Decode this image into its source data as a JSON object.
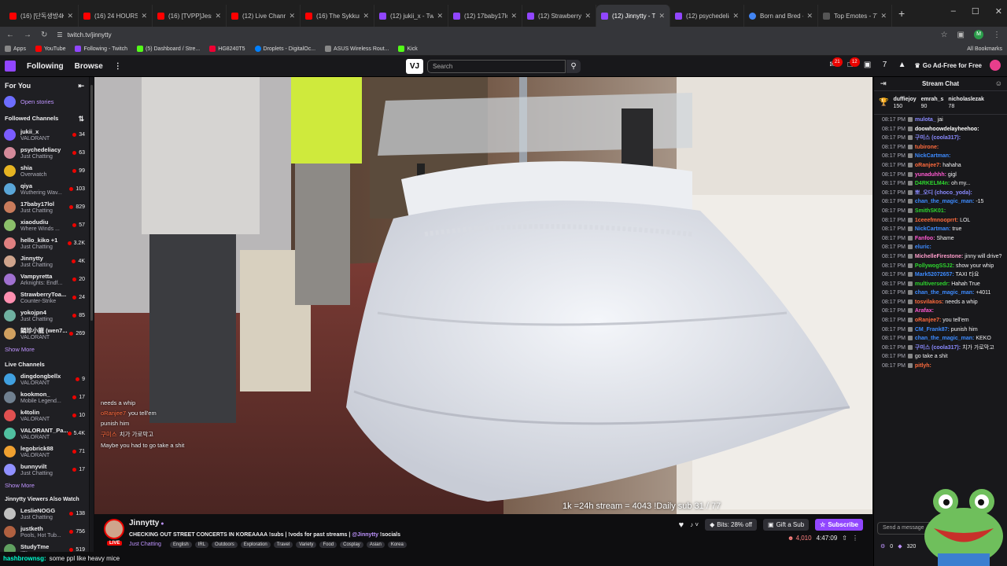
{
  "browser": {
    "tabs": [
      {
        "title": "(16) [단독생방4K] 뉴진",
        "fav": "yt"
      },
      {
        "title": "(16) 24 HOURS Eating",
        "fav": "yt"
      },
      {
        "title": "(16) [TVPP]Jessica(SN",
        "fav": "yt"
      },
      {
        "title": "(12) Live Channels You",
        "fav": "yt"
      },
      {
        "title": "(16) The Sykkuno Dram",
        "fav": "yt"
      },
      {
        "title": "(12) jukii_x - Twitch",
        "fav": "tw"
      },
      {
        "title": "(12) 17baby17lol - Twi",
        "fav": "tw"
      },
      {
        "title": "(12) StrawberryToastie",
        "fav": "tw"
      },
      {
        "title": "(12) Jinnytty - Twit",
        "fav": "tw",
        "active": true
      },
      {
        "title": "(12) psychedeliacy - Tw",
        "fav": "tw"
      },
      {
        "title": "Born and Bred - Goog",
        "fav": "g"
      },
      {
        "title": "Top Emotes - 7TV",
        "fav": "s"
      }
    ],
    "url": "twitch.tv/jinnytty",
    "bookmarks": [
      {
        "label": "Apps",
        "ic": "as"
      },
      {
        "label": "YouTube",
        "ic": "yt"
      },
      {
        "label": "Following - Twitch",
        "ic": "tw"
      },
      {
        "label": "(5) Dashboard / Stre...",
        "ic": "k"
      },
      {
        "label": "HG8240T5",
        "ic": "hg"
      },
      {
        "label": "Droplets - DigitalOc...",
        "ic": "do"
      },
      {
        "label": "ASUS Wireless Rout...",
        "ic": "as"
      },
      {
        "label": "Kick",
        "ic": "k"
      }
    ],
    "all_bookmarks": "All Bookmarks"
  },
  "nav": {
    "following": "Following",
    "browse": "Browse",
    "vj": "VJ",
    "search_placeholder": "Search",
    "notif_count": "21",
    "inbox_count": "12",
    "ad_free": "Go Ad-Free for Free"
  },
  "sidebar": {
    "for_you": "For You",
    "open_stories": "Open stories",
    "followed_title": "Followed Channels",
    "followed": [
      {
        "name": "jukii_x",
        "game": "VALORANT",
        "viewers": "34"
      },
      {
        "name": "psychedeliacy",
        "game": "Just Chatting",
        "viewers": "63"
      },
      {
        "name": "shia",
        "game": "Overwatch",
        "viewers": "99"
      },
      {
        "name": "qiya",
        "game": "Wuthering Wav...",
        "viewers": "103"
      },
      {
        "name": "17baby17lol",
        "game": "Just Chatting",
        "viewers": "829"
      },
      {
        "name": "xiaodudiu",
        "game": "Where Winds ...",
        "viewers": "57"
      },
      {
        "name": "hello_kiko +1",
        "game": "Just Chatting",
        "viewers": "3.2K"
      },
      {
        "name": "Jinnytty",
        "game": "Just Chatting",
        "viewers": "4K"
      },
      {
        "name": "Vampyretta",
        "game": "Arknights: Endf...",
        "viewers": "20"
      },
      {
        "name": "StrawberryToa...",
        "game": "Counter-Strike",
        "viewers": "24"
      },
      {
        "name": "yokojpn4",
        "game": "Just Chatting",
        "viewers": "85"
      },
      {
        "name": "鍋珍小龍 (wen7...",
        "game": "VALORANT",
        "viewers": "269"
      }
    ],
    "show_more": "Show More",
    "live_title": "Live Channels",
    "live": [
      {
        "name": "dingdongbellx",
        "game": "VALORANT",
        "viewers": "9"
      },
      {
        "name": "kookmon_",
        "game": "Mobile Legend...",
        "viewers": "17"
      },
      {
        "name": "k4tolin",
        "game": "VALORANT",
        "viewers": "10"
      },
      {
        "name": "VALORANT_Pa...",
        "game": "VALORANT",
        "viewers": "5.4K"
      },
      {
        "name": "legobrick88",
        "game": "VALORANT",
        "viewers": "71"
      },
      {
        "name": "bunnyvilt",
        "game": "Just Chatting",
        "viewers": "17"
      }
    ],
    "also_title": "Jinnytty Viewers Also Watch",
    "also": [
      {
        "name": "LeslieNOGG",
        "game": "Just Chatting",
        "viewers": "138"
      },
      {
        "name": "justketh",
        "game": "Pools, Hot Tub...",
        "viewers": "756"
      },
      {
        "name": "StudyTme",
        "game": "IRL",
        "viewers": "519"
      }
    ]
  },
  "video": {
    "overlay_chat": [
      {
        "user": "",
        "text": "needs a whip"
      },
      {
        "user": "oRanjee7",
        "text": "you tell'em"
      },
      {
        "user": "",
        "text": "punish him"
      },
      {
        "user": "구미스",
        "text": "치가 가로막고"
      },
      {
        "user": "",
        "text": "Maybe you had to go take a shit"
      }
    ],
    "stream_counter": "1k =24h stream = 4043   !Daily sub 31 / 77"
  },
  "info": {
    "channel": "Jinnytty",
    "live": "LIVE",
    "title": "CHECKING OUT STREET CONCERTS IN KOREAAAA !subs | !vods for past streams | ",
    "title_link": "@Jinnytty",
    "title_end": " !socials",
    "category": "Just Chatting",
    "tags": [
      "English",
      "IRL",
      "Outdoors",
      "Exploration",
      "Travel",
      "Variety",
      "Food",
      "Cosplay",
      "Asian",
      "Korea"
    ],
    "bits": "Bits: 28% off",
    "gift": "Gift a Sub",
    "subscribe": "Subscribe",
    "viewers": "4,010",
    "uptime": "4:47:09"
  },
  "bottom_chat": {
    "user": "hashbrownsg:",
    "text": "some ppl like heavy mice"
  },
  "chat": {
    "title": "Stream Chat",
    "leaders": [
      {
        "name": "duffiejoy",
        "amount": "150"
      },
      {
        "name": "emrah_s",
        "amount": "90"
      },
      {
        "name": "nicholaslezak",
        "amount": "78"
      }
    ],
    "messages": [
      {
        "ts": "08:17 PM",
        "user": "mulota_",
        "color": "#8a8aff",
        "text": "jai"
      },
      {
        "ts": "08:17 PM",
        "user": "doowhoowdelayheehoo:",
        "color": "#ffffff",
        "text": ""
      },
      {
        "ts": "08:17 PM",
        "user": "구미스 (coola317):",
        "color": "#8a8aff",
        "text": ""
      },
      {
        "ts": "08:17 PM",
        "user": "tubirone:",
        "color": "#ff6b3d",
        "text": ""
      },
      {
        "ts": "08:17 PM",
        "user": "NickCartman:",
        "color": "#3d8bff",
        "text": ""
      },
      {
        "ts": "08:17 PM",
        "user": "oRanjee7:",
        "color": "#ff6b3d",
        "text": "hahaha"
      },
      {
        "ts": "08:17 PM",
        "user": "yunaduhhh:",
        "color": "#ff5ad1",
        "text": "gigl"
      },
      {
        "ts": "08:17 PM",
        "user": "D4RKELM4n:",
        "color": "#2ed52e",
        "text": "oh my..."
      },
      {
        "ts": "08:17 PM",
        "user": "뽀_오디 (choco_yoda):",
        "color": "#8a8aff",
        "text": ""
      },
      {
        "ts": "08:17 PM",
        "user": "chan_the_magic_man:",
        "color": "#3d8bff",
        "text": "-15"
      },
      {
        "ts": "08:17 PM",
        "user": "SmithSK01:",
        "color": "#2ed52e",
        "text": ""
      },
      {
        "ts": "08:17 PM",
        "user": "1ceeefmnooprrt:",
        "color": "#ff6b3d",
        "text": "LOL"
      },
      {
        "ts": "08:17 PM",
        "user": "NickCartman:",
        "color": "#3d8bff",
        "text": "true"
      },
      {
        "ts": "08:17 PM",
        "user": "Fanfoo:",
        "color": "#ff5ad1",
        "text": "Shame"
      },
      {
        "ts": "08:17 PM",
        "user": "eluric:",
        "color": "#3d8bff",
        "text": ""
      },
      {
        "ts": "08:17 PM",
        "user": "MichelleFirestone:",
        "color": "#ff9dcb",
        "text": "jinny will drive?"
      },
      {
        "ts": "08:17 PM",
        "user": "PollywogSSJ2:",
        "color": "#2ed52e",
        "text": "show your whip"
      },
      {
        "ts": "08:17 PM",
        "user": "Mark52072657:",
        "color": "#3d8bff",
        "text": "TAXI 타요"
      },
      {
        "ts": "08:17 PM",
        "user": "multiversedr:",
        "color": "#2ed52e",
        "text": "Hahah True"
      },
      {
        "ts": "08:17 PM",
        "user": "chan_the_magic_man:",
        "color": "#3d8bff",
        "text": "+4011"
      },
      {
        "ts": "08:17 PM",
        "user": "tosvilakos:",
        "color": "#ff6b3d",
        "text": "needs a whip"
      },
      {
        "ts": "08:17 PM",
        "user": "Arafax:",
        "color": "#ff5ad1",
        "text": ""
      },
      {
        "ts": "08:17 PM",
        "user": "oRanjee7:",
        "color": "#ff6b3d",
        "text": "you tell'em"
      },
      {
        "ts": "08:17 PM",
        "user": "CM_Frank87:",
        "color": "#3d8bff",
        "text": "punish him"
      },
      {
        "ts": "08:17 PM",
        "user": "chan_the_magic_man:",
        "color": "#3d8bff",
        "text": "KEKO"
      },
      {
        "ts": "08:17 PM",
        "user": "구미스 (coola317):",
        "color": "#8a8aff",
        "text": "치가 가로막고"
      },
      {
        "ts": "08:17 PM",
        "user": "",
        "color": "#ff6b3d",
        "text": "go take a shit"
      },
      {
        "ts": "08:17 PM",
        "user": "pitlyh:",
        "color": "#ff6b3d",
        "text": ""
      }
    ],
    "input_placeholder": "Send a message",
    "points": "0",
    "bits_count": "320"
  }
}
